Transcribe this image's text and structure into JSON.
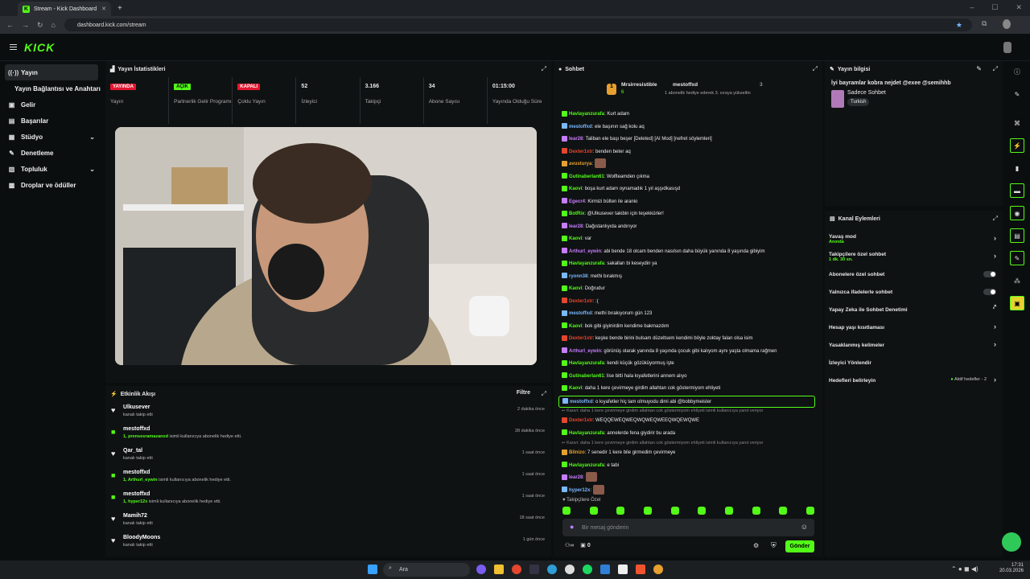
{
  "browser": {
    "tab_title": "Stream - Kick Dashboard",
    "url": "dashboard.kick.com/stream"
  },
  "sidebar": {
    "items": [
      {
        "label": "Yayın"
      },
      {
        "label": "Yayın Bağlantısı ve Anahtarı"
      },
      {
        "label": "Gelir"
      },
      {
        "label": "Başarılar"
      },
      {
        "label": "Stüdyo"
      },
      {
        "label": "Denetleme"
      },
      {
        "label": "Topluluk"
      },
      {
        "label": "Droplar ve ödüller"
      }
    ]
  },
  "stats": {
    "title": "Yayın İstatistikleri",
    "items": [
      {
        "value": "YAYINDA",
        "label": "Yayın"
      },
      {
        "value": "AÇIK",
        "label": "Partnerlik Gelir Programı"
      },
      {
        "value": "KAPALI",
        "label": "Çoklu Yayın"
      },
      {
        "value": "52",
        "label": "İzleyici"
      },
      {
        "value": "3.166",
        "label": "Takipçi"
      },
      {
        "value": "34",
        "label": "Abone Sayısı"
      },
      {
        "value": "01:15:00",
        "label": "Yayında Olduğu Süre"
      }
    ]
  },
  "activity": {
    "title": "Etkinlik Akışı",
    "filter": "Filtre",
    "items": [
      {
        "name": "Ulkusever",
        "detail": "kanalı takip etti",
        "time": "2 dakika önce"
      },
      {
        "name": "mestoffxd",
        "highlight": "1, prensesramazanxd",
        "detail": "isimli kullanıcıya abonelik hediye etti.",
        "time": "28 dakika önce"
      },
      {
        "name": "Qar_tal",
        "detail": "kanalı takip etti",
        "time": "1 saat önce"
      },
      {
        "name": "mestoffxd",
        "highlight": "1, Arthurl_eywin",
        "detail": "isimli kullanıcıya abonelik hediye etti.",
        "time": "1 saat önce"
      },
      {
        "name": "mestoffxd",
        "highlight": "1, hyper12x",
        "detail": "isimli kullanıcıya abonelik hediye etti.",
        "time": "1 saat önce"
      },
      {
        "name": "Mamih72",
        "detail": "kanalı takip etti",
        "time": "18 saat önce"
      },
      {
        "name": "BloodyMoons",
        "detail": "kanalı takip etti",
        "time": "1 gün önce"
      }
    ]
  },
  "chat": {
    "title": "Sohbet",
    "pinned": {
      "user1": "Mrsirresistible",
      "user1_count": "6",
      "user2": "mestoffxd",
      "user2_count": "3",
      "note": "1 abonelik hediye ederek 3. sıraya yükseltin"
    },
    "messages": [
      {
        "user": "Havlayanzurafa",
        "color": "#53fc18",
        "text": "Kurt adam"
      },
      {
        "user": "mestoffxd",
        "color": "#7ab8ff",
        "text": "ele başının sağ kolu aq"
      },
      {
        "user": "lear28",
        "color": "#c77dff",
        "text": "Taliban ele başı beşer [Deleted] [AI Mod] [nefret söylemleri]"
      },
      {
        "user": "Dexter1xtr",
        "color": "#e5462f",
        "text": "benden beter aq"
      },
      {
        "user": "avusturya",
        "color": "#e5a02f",
        "text": ""
      },
      {
        "user": "Gutinaberlan61",
        "color": "#53fc18",
        "text": "Wolfteamden çıkma"
      },
      {
        "user": "Kaovi",
        "color": "#53fc18",
        "text": "boşa kurt adam oynamadık 1 yıl aşşıdkasışd"
      },
      {
        "user": "Egecr4",
        "color": "#c77dff",
        "text": "Kirmizi bülten ile aranio"
      },
      {
        "user": "BotRix",
        "color": "#53fc18",
        "text": "@Ulkusever takibin için teşekkürler!"
      },
      {
        "user": "lear28",
        "color": "#c77dff",
        "text": "Dağıstanlıyıda andırıyor"
      },
      {
        "user": "Kaovi",
        "color": "#53fc18",
        "text": "var"
      },
      {
        "user": "Arthurl_eywin",
        "color": "#c77dff",
        "text": "abi bende 18 olcam benden nasılsın daha büyük yanında 8 yaşında gibiyim"
      },
      {
        "user": "Havlayanzurafa",
        "color": "#53fc18",
        "text": "sakalları bi keseydin ya"
      },
      {
        "user": "ryonn38",
        "color": "#7ab8ff",
        "text": "methi bırakmış"
      },
      {
        "user": "Kaovi",
        "color": "#53fc18",
        "text": "Doğrudur"
      },
      {
        "user": "Dexter1xtr",
        "color": "#e5462f",
        "text": ":("
      },
      {
        "user": "mestoffxd",
        "color": "#7ab8ff",
        "text": "methi bırakıyorum gün 123"
      },
      {
        "user": "Kaovi",
        "color": "#53fc18",
        "text": "bok gibi giyinirdim kendime bakmazdım"
      },
      {
        "user": "Dexter1xtr",
        "color": "#e5462f",
        "text": "keşke bende birini bulsam düzeltsem kendimi böyle zoktay falan olsa isim"
      },
      {
        "user": "Arthurl_eywin",
        "color": "#c77dff",
        "text": "görünüş olarak yanında 8 yaşında çocuk gibi kalıyom aynı yaşta olmama rağmen"
      },
      {
        "user": "Havlayanzurafa",
        "color": "#53fc18",
        "text": "kendi küçük gözüküyormuş işte"
      },
      {
        "user": "Gutinaberlan61",
        "color": "#53fc18",
        "text": "lise bitti hala kıyafetlerini annem alıyo"
      },
      {
        "user": "Kaovi",
        "color": "#53fc18",
        "text": "daha 1 kere çevirmeye girdim allahtan cok göstermiyom ehliyeti"
      },
      {
        "user": "mestoffxd",
        "color": "#7ab8ff",
        "text": "o kıyafetler hiç tam olmuyodu dimi abi @bobbymeister",
        "highlight": true
      },
      {
        "reply": "Kaovi: daha 1 kere çevirmeye girdim allahtan cok göstermiyom ehliyeti isimli kullanıcıya yanıt veriyor"
      },
      {
        "user": "Dexter1xtr",
        "color": "#e5462f",
        "text": "WEQQEWEQWEQWQWEQWEEQWQEWQWE"
      },
      {
        "user": "Havlayanzurafa",
        "color": "#53fc18",
        "text": "annelerde fena giydirir bu arada"
      },
      {
        "reply": "Kaovi: daha 1 kere çevirmeye girdim allahtan cok göstermiyom ehliyeti isimli kullanıcıya yanıt veriyor"
      },
      {
        "user": "Bilnizo",
        "color": "#e5a02f",
        "text": "7 senedir 1 kere bile girmedim çevirmeye"
      },
      {
        "user": "Havlayanzurafa",
        "color": "#53fc18",
        "text": "e tabi"
      },
      {
        "user": "lear28",
        "color": "#c77dff",
        "text": ""
      },
      {
        "user": "hyper12x",
        "color": "#7ab8ff",
        "text": ""
      }
    ],
    "followers_only": "Takipçilere Özel",
    "input_placeholder": "Bir mesaj gönderin",
    "count": "0",
    "send_label": "Gönder"
  },
  "stream_info": {
    "title": "Yayın bilgisi",
    "stream_title": "İyi bayramlar kobra nejdet @exee @semihhb",
    "category": "Sadece Sohbet",
    "tag": "Turkish"
  },
  "channel_actions": {
    "title": "Kanal Eylemleri",
    "items": [
      {
        "label": "Yavaş mod",
        "sub": "Anında",
        "kind": "arrow"
      },
      {
        "label": "Takipçilere özel sohbet",
        "sub": "1 dk. 30 sn.",
        "kind": "arrow"
      },
      {
        "label": "Abonelere özel sohbet",
        "kind": "toggle"
      },
      {
        "label": "Yalnızca ifadelerle sohbet",
        "kind": "toggle"
      },
      {
        "label": "Yapay Zeka ile Sohbet Denetimi",
        "kind": "ext"
      },
      {
        "label": "Hesap yaşı kısıtlaması",
        "kind": "arrow"
      },
      {
        "label": "Yasaklanmış kelimeler",
        "kind": "arrow"
      },
      {
        "label": "İzleyici Yönlendir",
        "kind": "none"
      },
      {
        "label": "Hedefleri belirleyin",
        "extra": "Aktif hedefler - 2",
        "kind": "arrow"
      }
    ]
  },
  "taskbar": {
    "search": "Ara",
    "time": "17:31",
    "date": "20.03.2026"
  }
}
